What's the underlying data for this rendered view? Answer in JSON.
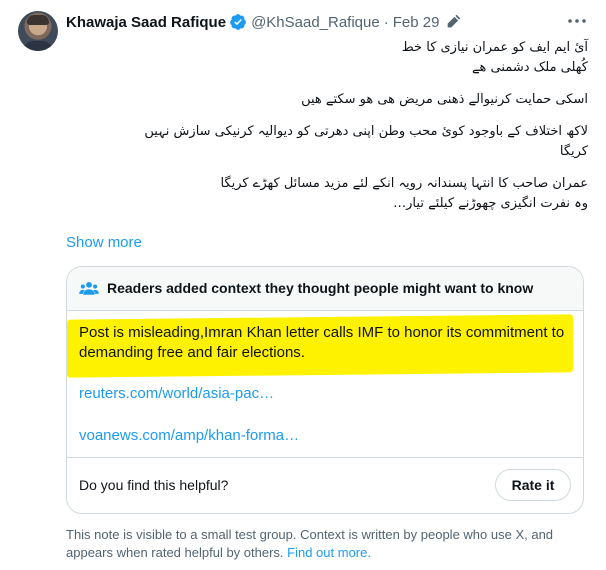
{
  "author": {
    "display_name": "Khawaja Saad Rafique",
    "handle": "@KhSaad_Rafique",
    "separator": "·",
    "date": "Feb 29"
  },
  "tweet": {
    "lines": [
      "آئ ایم ایف کو عمران نیازی کا خط",
      "کُھلی ملک دشمنی ھے",
      "اسکی حمایت کرنیوالے ذھنی مریض ھی ھو سکتے ھیں",
      "لاکھ اختلاف کے باوجود کوئ محب وطن اپنی دھرتی کو دیوالیہ کرنیکی سازش نہیں",
      "کریگا",
      "عمران صاحب کا انتہا پسندانہ رویہ انکے لئے مزید مسائل کھڑے کریگا",
      "وہ نفرت انگیزی چھوڑنے کیلئے تیار…"
    ],
    "show_more": "Show more"
  },
  "note": {
    "title": "Readers added context they thought people might want to know",
    "text": "Post is misleading,Imran Khan letter calls IMF to honor its commitment to demanding free and fair elections.",
    "links": [
      "reuters.com/world/asia-pac…",
      "voanews.com/amp/khan-forma…"
    ],
    "helpful_question": "Do you find this helpful?",
    "rate_label": "Rate it",
    "highlight_color": "#fff200"
  },
  "footer": {
    "text": "This note is visible to a small test group. Context is written by people who use X, and appears when rated helpful by others.",
    "link": "Find out more."
  },
  "colors": {
    "accent": "#1d9bf0",
    "muted": "#536471",
    "border": "#cfd9de"
  },
  "icons": [
    "verified-badge-icon",
    "edit-icon",
    "more-icon",
    "people-icon"
  ]
}
